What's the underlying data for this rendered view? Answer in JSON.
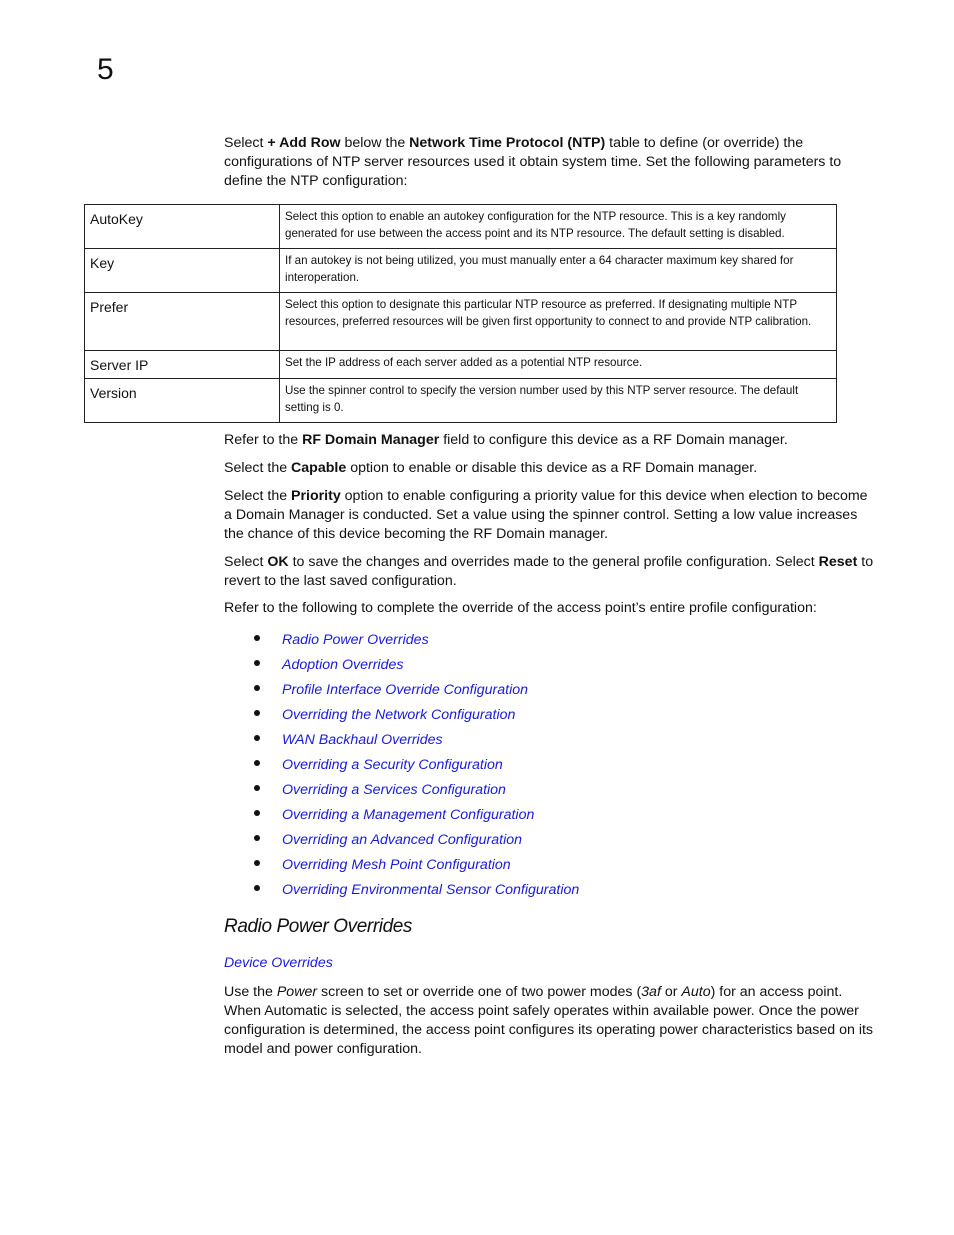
{
  "chapter": {
    "number": "5"
  },
  "intro": {
    "t1": "Select ",
    "b1": "+ Add Row",
    "t2": " below the ",
    "b2": "Network Time Protocol (NTP)",
    "t3": " table to define (or override) the configurations of NTP server resources used it obtain system time. Set the following parameters to define the NTP configuration:"
  },
  "ntp_table": {
    "rows": [
      {
        "param": "AutoKey",
        "description": "Select this option to enable an autokey configuration for the NTP resource. This is a key randomly generated for use between the access point and its NTP resource. The default setting is disabled."
      },
      {
        "param": "Key",
        "description": "If an autokey is not being utilized, you must manually enter a 64 character maximum key shared for interoperation."
      },
      {
        "param": "Prefer",
        "description": "Select this option to designate this particular NTP resource as preferred. If designating multiple NTP resources, preferred resources will be given first opportunity to connect to and provide NTP calibration."
      },
      {
        "param": "Server IP",
        "description": "Set the IP address of each server added as a potential NTP resource."
      },
      {
        "param": "Version",
        "description": "Use the spinner control to specify the version number used by this NTP server resource. The default setting is 0."
      }
    ]
  },
  "rf_domain": {
    "t1": "Refer to the ",
    "b1": "RF Domain Manager",
    "t2": " field to configure this device as a RF Domain manager."
  },
  "capable": {
    "t1": "Select the ",
    "b1": "Capable",
    "t2": " option to enable or disable this device as a RF Domain manager."
  },
  "priority": {
    "t1": "Select the ",
    "b1": "Priority",
    "t2": " option to enable configuring a priority value for this device when election to become a Domain Manager is conducted. Set a value using the spinner control. Setting a low value increases the chance of this device becoming the RF Domain manager."
  },
  "ok_reset": {
    "t1": "Select ",
    "b1": "OK",
    "t2": " to save the changes and overrides made to the general profile configuration. Select ",
    "b2": "Reset",
    "t3": " to revert to the last saved configuration."
  },
  "refer_list_intro": "Refer to the following to complete the override of the access point’s entire profile configuration:",
  "links": [
    "Radio Power Overrides",
    "Adoption Overrides",
    "Profile Interface Override Configuration",
    "Overriding the Network Configuration",
    "WAN Backhaul Overrides",
    "Overriding a Security Configuration",
    "Overriding a Services Configuration",
    "Overriding a Management Configuration",
    "Overriding an Advanced Configuration",
    "Overriding Mesh Point Configuration",
    "Overriding Environmental Sensor Configuration"
  ],
  "section": {
    "heading": "Radio Power Overrides",
    "breadcrumb_link": "Device Overrides",
    "body": {
      "t1": "Use the ",
      "i1": "Power",
      "t2": " screen to set or override one of two power modes (",
      "i2": "3af",
      "t3": " or ",
      "i3": "Auto",
      "t4": ") for an access point. When Automatic is selected, the access point safely operates within available power. Once the power configuration is determined, the access point configures its operating power characteristics based on its model and power configuration."
    }
  }
}
